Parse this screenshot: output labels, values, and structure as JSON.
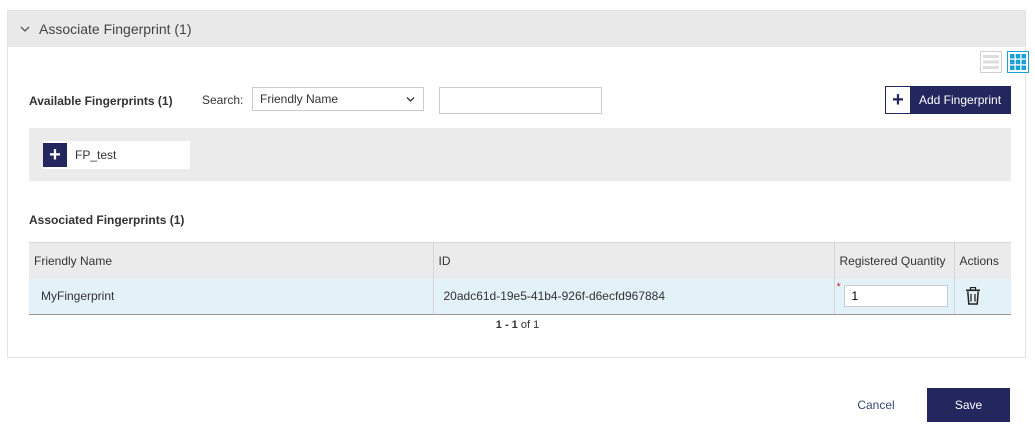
{
  "panel": {
    "title": "Associate Fingerprint (1)"
  },
  "view_icons": [
    "list-view-icon",
    "grid-view-icon"
  ],
  "available": {
    "label": "Available Fingerprints (1)",
    "search_label": "Search:",
    "search_field_selected": "Friendly Name",
    "search_value": "",
    "add_button_label": "Add Fingerprint",
    "items": [
      {
        "label": "FP_test"
      }
    ]
  },
  "associated": {
    "label": "Associated Fingerprints (1)",
    "columns": [
      "Friendly Name",
      "ID",
      "Registered Quantity",
      "Actions"
    ],
    "rows": [
      {
        "friendly_name": "MyFingerprint",
        "id": "20adc61d-19e5-41b4-926f-d6ecfd967884",
        "required_mark": "*",
        "quantity": "1"
      }
    ],
    "pager": {
      "range": "1 - 1",
      "of": "of",
      "total": "1"
    }
  },
  "footer": {
    "cancel_label": "Cancel",
    "save_label": "Save"
  },
  "colors": {
    "brand": "#23275d",
    "header_bg": "#e9e9e9",
    "row_highlight": "#e3f1f8",
    "grid_icon": "#1aa0d8"
  }
}
